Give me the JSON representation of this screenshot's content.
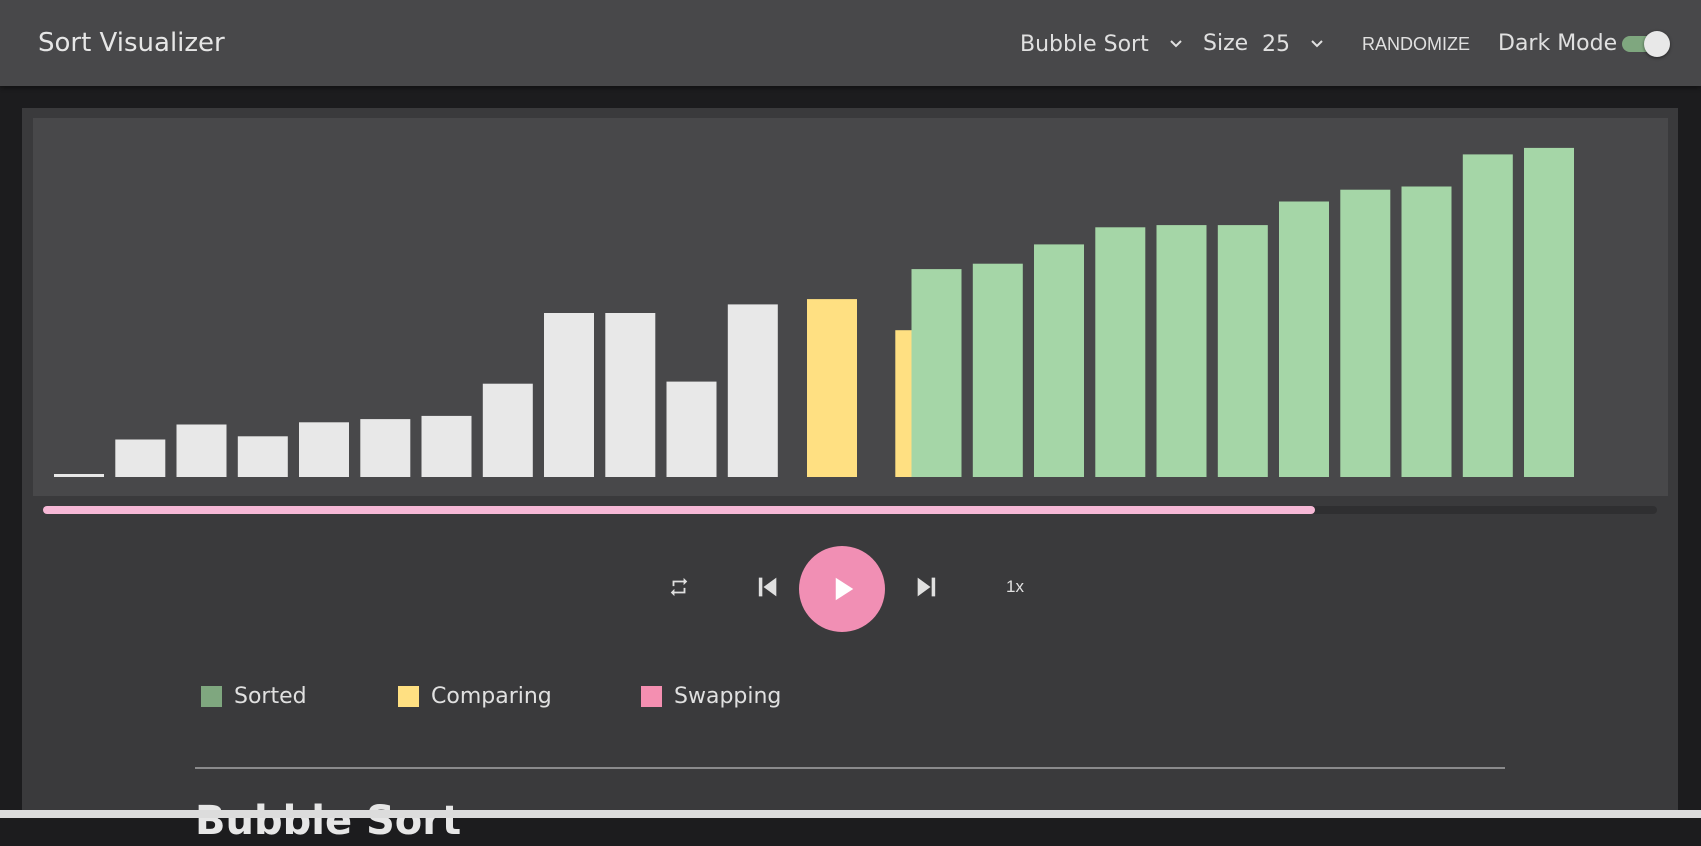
{
  "app": {
    "title": "Sort Visualizer",
    "algorithm_value": "Bubble Sort",
    "size_label": "Size",
    "size_value": "25",
    "randomize_label": "RANDOMIZE",
    "dark_mode_label": "Dark Mode",
    "dark_mode_on": true
  },
  "player": {
    "progress_fraction": 0.788,
    "speed_label": "1x"
  },
  "legend": {
    "sorted": {
      "label": "Sorted",
      "color": "#7fa77f"
    },
    "comparing": {
      "label": "Comparing",
      "color": "#ffe082"
    },
    "swapping": {
      "label": "Swapping",
      "color": "#f48fb1"
    }
  },
  "section": {
    "heading": "Bubble Sort"
  },
  "colors": {
    "bar_default": "#e8e8e8",
    "bar_comparing": "#ffe082",
    "bar_sorted": "#a5d6a7",
    "accent": "#f18fb4"
  },
  "chart_data": {
    "type": "bar",
    "values": [
      1,
      35,
      49,
      38,
      51,
      54,
      57,
      87,
      153,
      153,
      89,
      161,
      166,
      137,
      194,
      199,
      217,
      233,
      235,
      235,
      257,
      268,
      271,
      301,
      307
    ],
    "states": [
      "default",
      "default",
      "default",
      "default",
      "default",
      "default",
      "default",
      "default",
      "default",
      "default",
      "default",
      "default",
      "comparing",
      "comparing",
      "sorted",
      "sorted",
      "sorted",
      "sorted",
      "sorted",
      "sorted",
      "sorted",
      "sorted",
      "sorted",
      "sorted",
      "sorted"
    ],
    "ylim": [
      0,
      320
    ]
  }
}
